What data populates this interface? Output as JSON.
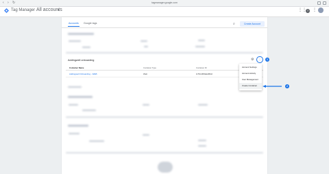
{
  "browser": {
    "url": "tagmanager.google.com",
    "nav": [
      "‹",
      "›",
      "↻"
    ]
  },
  "app": {
    "title": "Tag Manager",
    "account_switch": "All accounts"
  },
  "tabs": [
    {
      "label": "Accounts"
    },
    {
      "label": "Google tags"
    }
  ],
  "toolbar": {
    "create_account_label": "Create Account"
  },
  "account": {
    "name": "Addingwell onboarding",
    "columns": [
      "Container Name",
      "Container Type",
      "Container ID"
    ],
    "container": {
      "name": "Addingwell Onboarding - WEB",
      "type": "Web",
      "id": "GTM-M8GEABGF"
    }
  },
  "menu": {
    "items": [
      "Account Settings",
      "Account Activity",
      "User Management",
      "Create Container"
    ],
    "highlighted": "Create Container"
  },
  "steps": [
    "1",
    "2"
  ],
  "colors": {
    "accent": "#1a73e8",
    "page_bg": "#eceff1"
  }
}
